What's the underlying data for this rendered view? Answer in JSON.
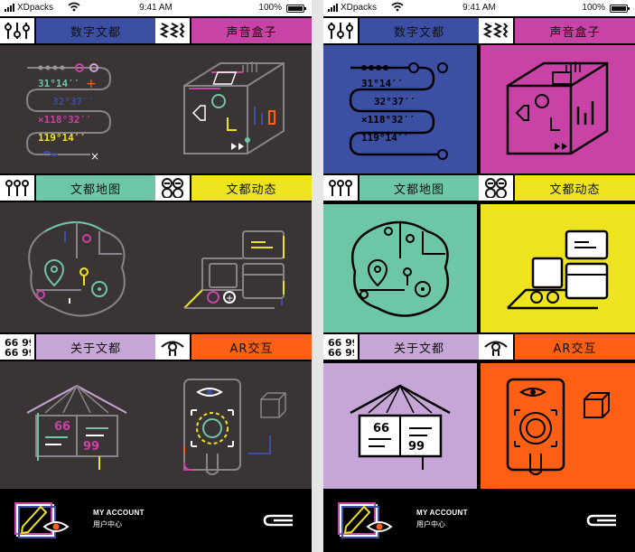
{
  "status_bar": {
    "carrier": "XDpacks",
    "time": "9:41 AM",
    "battery": "100%"
  },
  "sections": [
    {
      "key": "digital",
      "label": "数字文都",
      "icon": "sliders-icon",
      "color": "#3d4fa3",
      "dark_bg": "#3b3435"
    },
    {
      "key": "sound",
      "label": "声音盒子",
      "icon": "waveform-icon",
      "color": "#c843a5",
      "dark_bg": "#3b3435"
    },
    {
      "key": "map",
      "label": "文都地图",
      "icon": "map-pins-icon",
      "color": "#6dc6a6",
      "dark_bg": "#3b3435"
    },
    {
      "key": "news",
      "label": "文都动态",
      "icon": "news-circles-icon",
      "color": "#ede41f",
      "dark_bg": "#3b3435"
    },
    {
      "key": "about",
      "label": "关于文都",
      "icon": "quote-icon",
      "color": "#c6a6d6",
      "dark_bg": "#3b3435"
    },
    {
      "key": "ar",
      "label": "AR交互",
      "icon": "eye-icon",
      "color": "#fd5f14",
      "dark_bg": "#3b3435"
    }
  ],
  "footer": {
    "account_en": "MY ACCOUNT",
    "account_zh": "用户中心"
  },
  "colors": {
    "dark_panel": "#3b3435",
    "line_dark": "#000000",
    "gap": "#e5e5e5"
  }
}
